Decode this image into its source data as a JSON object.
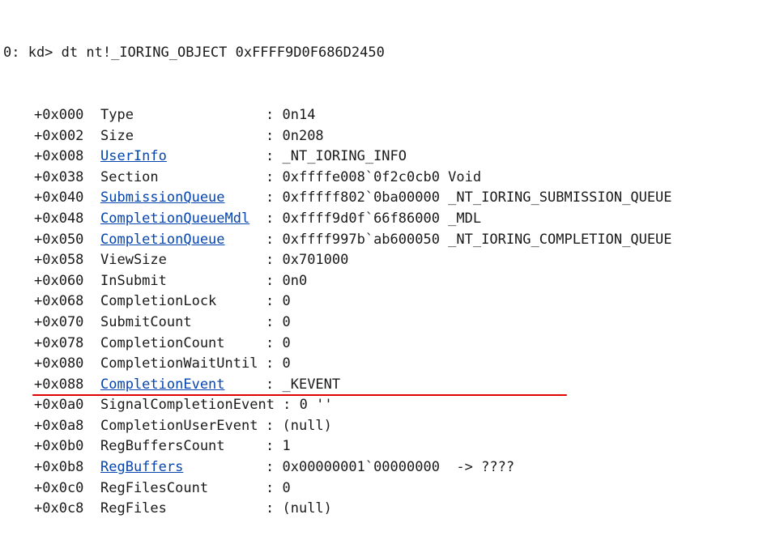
{
  "prompt": "0: kd>",
  "command": "dt nt!_IORING_OBJECT 0xFFFF9D0F686D2450",
  "rows": [
    {
      "offset": "+0x000",
      "field": "Type",
      "link": false,
      "sep": " : ",
      "value": "0n14"
    },
    {
      "offset": "+0x002",
      "field": "Size",
      "link": false,
      "sep": " : ",
      "value": "0n208"
    },
    {
      "offset": "+0x008",
      "field": "UserInfo",
      "link": true,
      "sep": " : ",
      "value": "_NT_IORING_INFO"
    },
    {
      "offset": "+0x038",
      "field": "Section",
      "link": false,
      "sep": " : ",
      "value": "0xffffe008`0f2c0cb0 Void"
    },
    {
      "offset": "+0x040",
      "field": "SubmissionQueue",
      "link": true,
      "sep": " : ",
      "value": "0xfffff802`0ba00000 _NT_IORING_SUBMISSION_QUEUE"
    },
    {
      "offset": "+0x048",
      "field": "CompletionQueueMdl",
      "link": true,
      "sep": " : ",
      "value": "0xffff9d0f`66f86000 _MDL"
    },
    {
      "offset": "+0x050",
      "field": "CompletionQueue",
      "link": true,
      "sep": " : ",
      "value": "0xffff997b`ab600050 _NT_IORING_COMPLETION_QUEUE"
    },
    {
      "offset": "+0x058",
      "field": "ViewSize",
      "link": false,
      "sep": " : ",
      "value": "0x701000"
    },
    {
      "offset": "+0x060",
      "field": "InSubmit",
      "link": false,
      "sep": " : ",
      "value": "0n0"
    },
    {
      "offset": "+0x068",
      "field": "CompletionLock",
      "link": false,
      "sep": " : ",
      "value": "0"
    },
    {
      "offset": "+0x070",
      "field": "SubmitCount",
      "link": false,
      "sep": " : ",
      "value": "0"
    },
    {
      "offset": "+0x078",
      "field": "CompletionCount",
      "link": false,
      "sep": " : ",
      "value": "0"
    },
    {
      "offset": "+0x080",
      "field": "CompletionWaitUntil",
      "link": false,
      "sep": " : ",
      "value": "0"
    },
    {
      "offset": "+0x088",
      "field": "CompletionEvent",
      "link": true,
      "sep": " : ",
      "value": "_KEVENT"
    },
    {
      "offset": "+0x0a0",
      "field": "SignalCompletionEvent",
      "link": false,
      "sep": " : ",
      "value": "0 ''"
    },
    {
      "offset": "+0x0a8",
      "field": "CompletionUserEvent",
      "link": false,
      "sep": " : ",
      "value": "(null)"
    },
    {
      "offset": "+0x0b0",
      "field": "RegBuffersCount",
      "link": false,
      "sep": " : ",
      "value": "1"
    },
    {
      "offset": "+0x0b8",
      "field": "RegBuffers",
      "link": true,
      "sep": " : ",
      "value": "0x00000001`00000000  -> ????"
    },
    {
      "offset": "+0x0c0",
      "field": "RegFilesCount",
      "link": false,
      "sep": " : ",
      "value": "0"
    },
    {
      "offset": "+0x0c8",
      "field": "RegFiles",
      "link": false,
      "sep": " : ",
      "value": "(null)"
    }
  ],
  "colors": {
    "link": "#0645ad",
    "text": "#1a1a1a",
    "highlight_underline": "#e00000",
    "background": "#ffffff"
  }
}
